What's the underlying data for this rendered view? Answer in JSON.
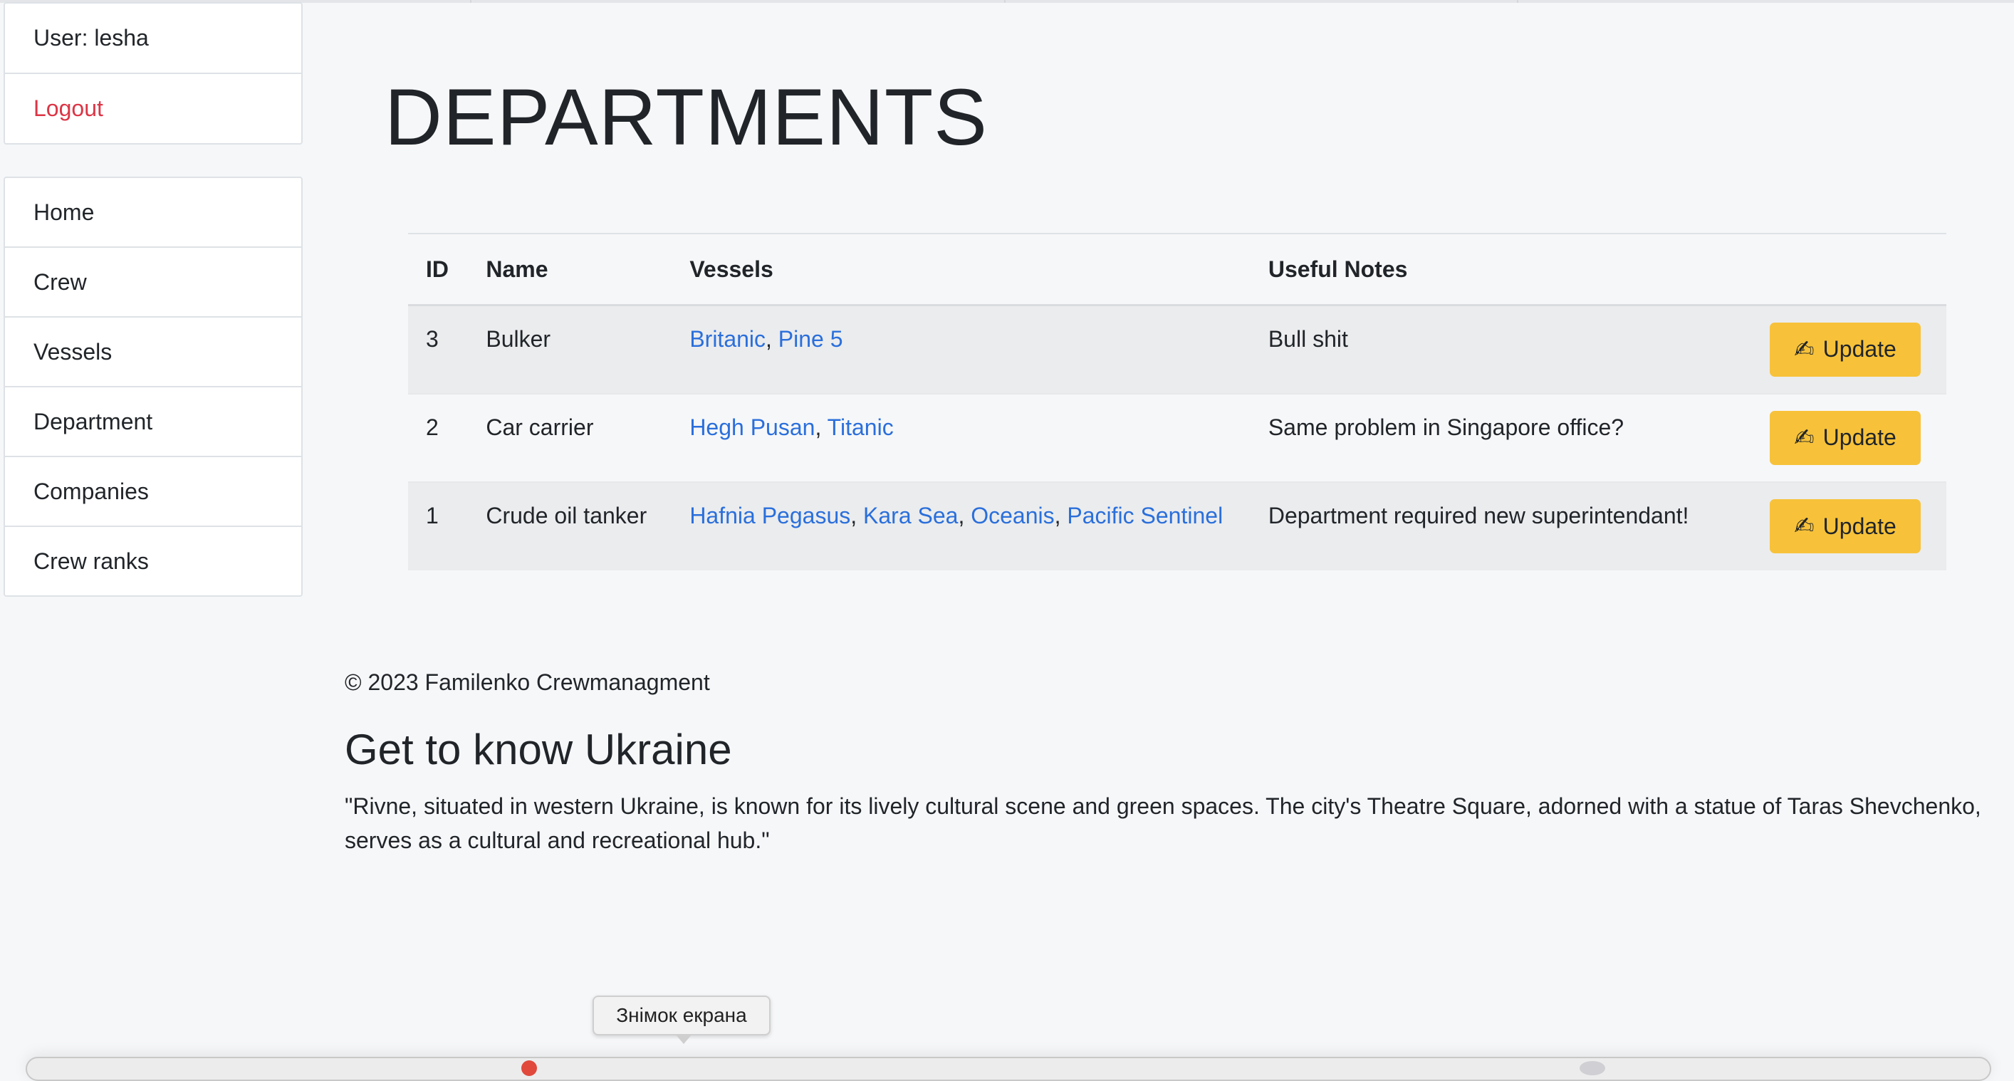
{
  "user_panel": {
    "user_label": "User: lesha",
    "logout_label": "Logout"
  },
  "sidebar": {
    "items": [
      {
        "label": "Home"
      },
      {
        "label": "Crew"
      },
      {
        "label": "Vessels"
      },
      {
        "label": "Department"
      },
      {
        "label": "Companies"
      },
      {
        "label": "Crew ranks"
      }
    ]
  },
  "page": {
    "title": "DEPARTMENTS"
  },
  "table": {
    "headers": {
      "id": "ID",
      "name": "Name",
      "vessels": "Vessels",
      "notes": "Useful Notes"
    },
    "update_label": "Update",
    "update_icon": "writing-hand-icon",
    "rows": [
      {
        "id": "3",
        "name": "Bulker",
        "vessels": [
          "Britanic",
          "Pine 5"
        ],
        "notes": "Bull shit"
      },
      {
        "id": "2",
        "name": "Car carrier",
        "vessels": [
          "Hegh Pusan",
          "Titanic"
        ],
        "notes": "Same problem in Singapore office?"
      },
      {
        "id": "1",
        "name": "Crude oil tanker",
        "vessels": [
          "Hafnia Pegasus",
          "Kara Sea",
          "Oceanis",
          "Pacific Sentinel"
        ],
        "notes": "Department required new superintendant!"
      }
    ]
  },
  "footer": {
    "copyright": "© 2023 Familenko Crewmanagment",
    "ukraine_title": "Get to know Ukraine",
    "ukraine_text": "\"Rivne, situated in western Ukraine, is known for its lively cultural scene and green spaces. The city's Theatre Square, adorned with a statue of Taras Shevchenko, serves as a cultural and recreational hub.\""
  },
  "tooltip": {
    "text": "Знімок екрана"
  },
  "colors": {
    "background": "#f6f7f9",
    "link": "#2a6fdb",
    "logout": "#dc3545",
    "update_button": "#f7c23a",
    "striped_row": "#ebecee"
  }
}
